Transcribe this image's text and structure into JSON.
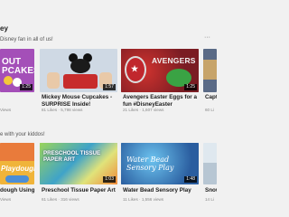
{
  "shelf1": {
    "title_fragment": "ey",
    "subtitle_fragment": "Disney fan in all of us!",
    "videos": [
      {
        "title": "",
        "duration": "1:25",
        "meta": "Views",
        "thumb_text": "OUT\nPCAKES"
      },
      {
        "title": "Mickey Mouse Cupcakes - SURPRISE Inside!",
        "duration": "1:57",
        "meta": "81 Likes  ·  5,798 views"
      },
      {
        "title": "Avengers Easter Eggs for a fun #DisneyEaster surprise!...",
        "duration": "1:25",
        "meta": "21 Likes  ·  1,607 views",
        "thumb_text": "AVENGERS"
      },
      {
        "title": "Capt",
        "duration": "",
        "meta": "60 Li"
      }
    ]
  },
  "shelf2": {
    "subtitle_fragment": "e with your kiddos!",
    "videos": [
      {
        "title": "dough Using",
        "duration": "",
        "meta": "Views",
        "thumb_text": "Playdough"
      },
      {
        "title": "Preschool Tissue Paper Art",
        "duration": "1:03",
        "meta": "61 Likes  ·  316 views",
        "thumb_text": "PRESCHOOL TISSUE PAPER ART"
      },
      {
        "title": "Water Bead Sensory Play",
        "duration": "1:48",
        "meta": "11 Likes  ·  1,556 views",
        "thumb_text": "Water Bead Sensory Play"
      },
      {
        "title": "Snow",
        "duration": "",
        "meta": "14 Li"
      }
    ]
  },
  "more_icon": "ellipsis-icon"
}
